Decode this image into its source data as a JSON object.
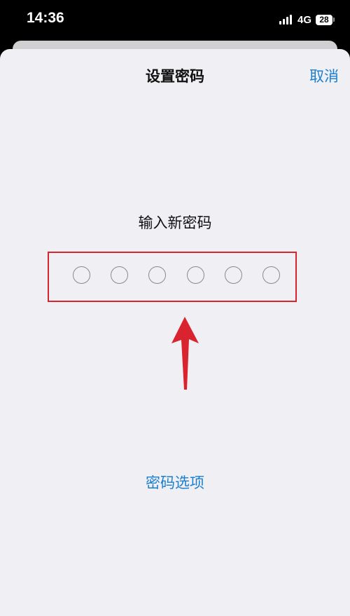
{
  "status_bar": {
    "time": "14:36",
    "network": "4G",
    "battery": "28"
  },
  "sheet": {
    "title": "设置密码",
    "cancel_label": "取消",
    "prompt": "输入新密码",
    "passcode_length": 6,
    "options_label": "密码选项"
  },
  "colors": {
    "accent": "#1a7fd0",
    "annotation": "#d9232f",
    "sheet_background": "#efeff4"
  }
}
